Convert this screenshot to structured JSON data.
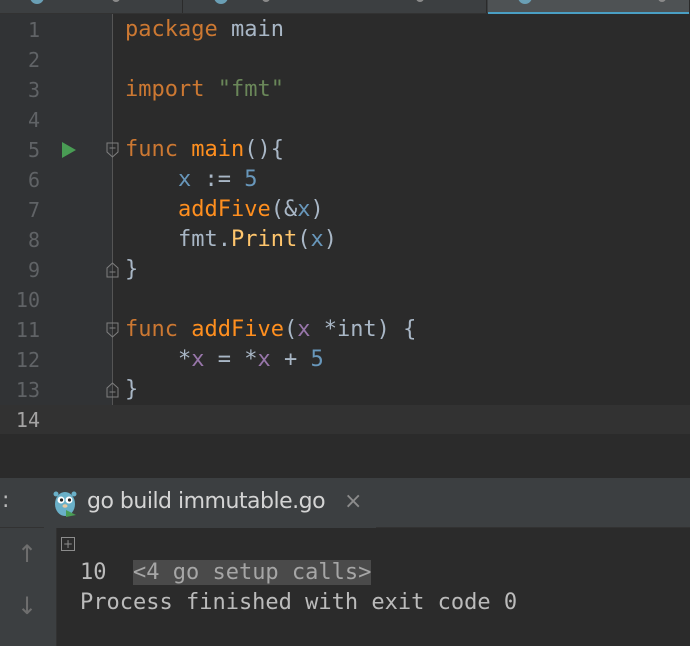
{
  "editor": {
    "lines": [
      {
        "num": "1",
        "tokens": [
          [
            "kw",
            "package"
          ],
          [
            "plain",
            " main"
          ]
        ]
      },
      {
        "num": "2",
        "tokens": []
      },
      {
        "num": "3",
        "tokens": [
          [
            "kw",
            "import"
          ],
          [
            "plain",
            " "
          ],
          [
            "str",
            "\"fmt\""
          ]
        ]
      },
      {
        "num": "4",
        "tokens": []
      },
      {
        "num": "5",
        "tokens": [
          [
            "kw",
            "func"
          ],
          [
            "plain",
            " "
          ],
          [
            "fn",
            "main"
          ],
          [
            "plain",
            "(){"
          ]
        ],
        "run": true,
        "fold": "open"
      },
      {
        "num": "6",
        "tokens": [
          [
            "plain",
            "    "
          ],
          [
            "var",
            "x"
          ],
          [
            "plain",
            " := "
          ],
          [
            "num",
            "5"
          ]
        ]
      },
      {
        "num": "7",
        "tokens": [
          [
            "plain",
            "    "
          ],
          [
            "fn",
            "addFive"
          ],
          [
            "plain",
            "(&"
          ],
          [
            "var",
            "x"
          ],
          [
            "plain",
            ")"
          ]
        ]
      },
      {
        "num": "8",
        "tokens": [
          [
            "plain",
            "    fmt."
          ],
          [
            "call",
            "Print"
          ],
          [
            "plain",
            "("
          ],
          [
            "var",
            "x"
          ],
          [
            "plain",
            ")"
          ]
        ]
      },
      {
        "num": "9",
        "tokens": [
          [
            "plain",
            "}"
          ]
        ],
        "fold": "close"
      },
      {
        "num": "10",
        "tokens": []
      },
      {
        "num": "11",
        "tokens": [
          [
            "kw",
            "func"
          ],
          [
            "plain",
            " "
          ],
          [
            "fn",
            "addFive"
          ],
          [
            "plain",
            "("
          ],
          [
            "pvar",
            "x"
          ],
          [
            "plain",
            " *int) {"
          ]
        ],
        "fold": "open"
      },
      {
        "num": "12",
        "tokens": [
          [
            "plain",
            "    *"
          ],
          [
            "pvar",
            "x"
          ],
          [
            "plain",
            " = *"
          ],
          [
            "pvar",
            "x"
          ],
          [
            "plain",
            " + "
          ],
          [
            "num",
            "5"
          ]
        ]
      },
      {
        "num": "13",
        "tokens": [
          [
            "plain",
            "}"
          ]
        ],
        "fold": "close"
      },
      {
        "num": "14",
        "tokens": [],
        "current": true
      }
    ]
  },
  "run_panel": {
    "colon": ":",
    "tab_label": "go build immutable.go",
    "close_glyph": "×"
  },
  "console": {
    "expand_glyph": "+",
    "setup_calls": "<4 go setup calls>",
    "output_line": "10",
    "exit_line": "Process finished with exit code 0",
    "up_arrow": "↑",
    "down_arrow": "↓"
  },
  "colors": {
    "keyword": "#cc7832",
    "string": "#6a8759",
    "function": "#ff8f1f",
    "number": "#6897bb",
    "param": "#9876aa",
    "call": "#ffc66d",
    "run_icon": "#499c54",
    "tab_underline": "#4a9fc4"
  }
}
